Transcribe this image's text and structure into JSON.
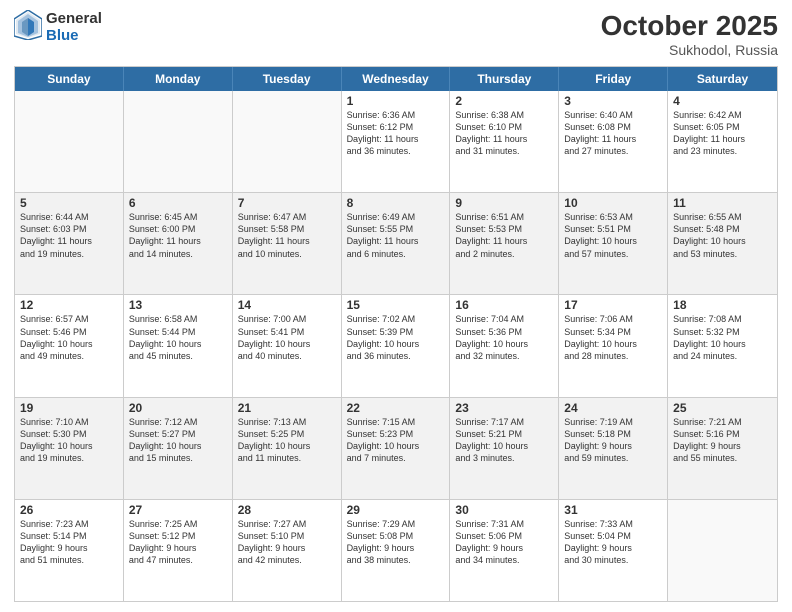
{
  "logo": {
    "general": "General",
    "blue": "Blue"
  },
  "title": "October 2025",
  "subtitle": "Sukhodol, Russia",
  "days": [
    "Sunday",
    "Monday",
    "Tuesday",
    "Wednesday",
    "Thursday",
    "Friday",
    "Saturday"
  ],
  "rows": [
    [
      {
        "num": "",
        "info": ""
      },
      {
        "num": "",
        "info": ""
      },
      {
        "num": "",
        "info": ""
      },
      {
        "num": "1",
        "info": "Sunrise: 6:36 AM\nSunset: 6:12 PM\nDaylight: 11 hours\nand 36 minutes."
      },
      {
        "num": "2",
        "info": "Sunrise: 6:38 AM\nSunset: 6:10 PM\nDaylight: 11 hours\nand 31 minutes."
      },
      {
        "num": "3",
        "info": "Sunrise: 6:40 AM\nSunset: 6:08 PM\nDaylight: 11 hours\nand 27 minutes."
      },
      {
        "num": "4",
        "info": "Sunrise: 6:42 AM\nSunset: 6:05 PM\nDaylight: 11 hours\nand 23 minutes."
      }
    ],
    [
      {
        "num": "5",
        "info": "Sunrise: 6:44 AM\nSunset: 6:03 PM\nDaylight: 11 hours\nand 19 minutes."
      },
      {
        "num": "6",
        "info": "Sunrise: 6:45 AM\nSunset: 6:00 PM\nDaylight: 11 hours\nand 14 minutes."
      },
      {
        "num": "7",
        "info": "Sunrise: 6:47 AM\nSunset: 5:58 PM\nDaylight: 11 hours\nand 10 minutes."
      },
      {
        "num": "8",
        "info": "Sunrise: 6:49 AM\nSunset: 5:55 PM\nDaylight: 11 hours\nand 6 minutes."
      },
      {
        "num": "9",
        "info": "Sunrise: 6:51 AM\nSunset: 5:53 PM\nDaylight: 11 hours\nand 2 minutes."
      },
      {
        "num": "10",
        "info": "Sunrise: 6:53 AM\nSunset: 5:51 PM\nDaylight: 10 hours\nand 57 minutes."
      },
      {
        "num": "11",
        "info": "Sunrise: 6:55 AM\nSunset: 5:48 PM\nDaylight: 10 hours\nand 53 minutes."
      }
    ],
    [
      {
        "num": "12",
        "info": "Sunrise: 6:57 AM\nSunset: 5:46 PM\nDaylight: 10 hours\nand 49 minutes."
      },
      {
        "num": "13",
        "info": "Sunrise: 6:58 AM\nSunset: 5:44 PM\nDaylight: 10 hours\nand 45 minutes."
      },
      {
        "num": "14",
        "info": "Sunrise: 7:00 AM\nSunset: 5:41 PM\nDaylight: 10 hours\nand 40 minutes."
      },
      {
        "num": "15",
        "info": "Sunrise: 7:02 AM\nSunset: 5:39 PM\nDaylight: 10 hours\nand 36 minutes."
      },
      {
        "num": "16",
        "info": "Sunrise: 7:04 AM\nSunset: 5:36 PM\nDaylight: 10 hours\nand 32 minutes."
      },
      {
        "num": "17",
        "info": "Sunrise: 7:06 AM\nSunset: 5:34 PM\nDaylight: 10 hours\nand 28 minutes."
      },
      {
        "num": "18",
        "info": "Sunrise: 7:08 AM\nSunset: 5:32 PM\nDaylight: 10 hours\nand 24 minutes."
      }
    ],
    [
      {
        "num": "19",
        "info": "Sunrise: 7:10 AM\nSunset: 5:30 PM\nDaylight: 10 hours\nand 19 minutes."
      },
      {
        "num": "20",
        "info": "Sunrise: 7:12 AM\nSunset: 5:27 PM\nDaylight: 10 hours\nand 15 minutes."
      },
      {
        "num": "21",
        "info": "Sunrise: 7:13 AM\nSunset: 5:25 PM\nDaylight: 10 hours\nand 11 minutes."
      },
      {
        "num": "22",
        "info": "Sunrise: 7:15 AM\nSunset: 5:23 PM\nDaylight: 10 hours\nand 7 minutes."
      },
      {
        "num": "23",
        "info": "Sunrise: 7:17 AM\nSunset: 5:21 PM\nDaylight: 10 hours\nand 3 minutes."
      },
      {
        "num": "24",
        "info": "Sunrise: 7:19 AM\nSunset: 5:18 PM\nDaylight: 9 hours\nand 59 minutes."
      },
      {
        "num": "25",
        "info": "Sunrise: 7:21 AM\nSunset: 5:16 PM\nDaylight: 9 hours\nand 55 minutes."
      }
    ],
    [
      {
        "num": "26",
        "info": "Sunrise: 7:23 AM\nSunset: 5:14 PM\nDaylight: 9 hours\nand 51 minutes."
      },
      {
        "num": "27",
        "info": "Sunrise: 7:25 AM\nSunset: 5:12 PM\nDaylight: 9 hours\nand 47 minutes."
      },
      {
        "num": "28",
        "info": "Sunrise: 7:27 AM\nSunset: 5:10 PM\nDaylight: 9 hours\nand 42 minutes."
      },
      {
        "num": "29",
        "info": "Sunrise: 7:29 AM\nSunset: 5:08 PM\nDaylight: 9 hours\nand 38 minutes."
      },
      {
        "num": "30",
        "info": "Sunrise: 7:31 AM\nSunset: 5:06 PM\nDaylight: 9 hours\nand 34 minutes."
      },
      {
        "num": "31",
        "info": "Sunrise: 7:33 AM\nSunset: 5:04 PM\nDaylight: 9 hours\nand 30 minutes."
      },
      {
        "num": "",
        "info": ""
      }
    ]
  ]
}
